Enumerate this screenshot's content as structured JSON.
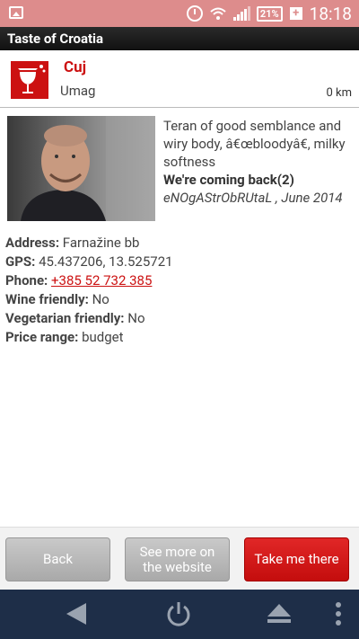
{
  "status": {
    "battery": "21%",
    "time": "18:18"
  },
  "app_title": "Taste of Croatia",
  "venue": {
    "name": "Cuj",
    "city": "Umag",
    "distance": "0 km"
  },
  "review": {
    "text": "Teran of good semblance and wiry body, â€œbloodyâ€, milky softness",
    "headline": "We're coming back(2)",
    "byline": "eNOgAStrObRUtaL , June 2014"
  },
  "info": {
    "address_label": "Address:",
    "address": "Farnažine bb",
    "gps_label": "GPS:",
    "gps": "45.437206, 13.525721",
    "phone_label": "Phone:",
    "phone": "+385 52 732 385",
    "wine_label": "Wine friendly:",
    "wine": "No",
    "veg_label": "Vegetarian friendly:",
    "veg": "No",
    "price_label": "Price range:",
    "price": "budget"
  },
  "buttons": {
    "back": "Back",
    "website_line1": "See more on",
    "website_line2": "the website",
    "take_me": "Take me there"
  },
  "colors": {
    "accent": "#cc1111",
    "status_bar": "#dd8c8c",
    "nav_bar": "#1e2e48"
  },
  "icons": [
    "image-icon",
    "alarm-icon",
    "wifi-icon",
    "signal-icon",
    "battery-icon",
    "back-nav-icon",
    "power-icon",
    "eject-icon",
    "menu-dots-icon",
    "wine-glass-logo"
  ]
}
